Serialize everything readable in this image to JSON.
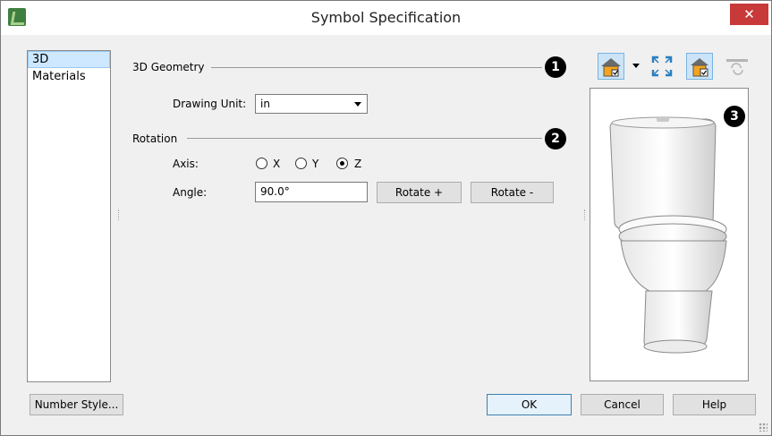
{
  "window": {
    "title": "Symbol Specification",
    "close_glyph": "✕"
  },
  "sidebar": {
    "items": [
      {
        "label": "3D",
        "selected": true
      },
      {
        "label": "Materials",
        "selected": false
      }
    ]
  },
  "geometry": {
    "section_label": "3D Geometry",
    "callout": "1",
    "drawing_unit_label": "Drawing Unit:",
    "drawing_unit_value": "in"
  },
  "rotation": {
    "section_label": "Rotation",
    "callout": "2",
    "axis_label": "Axis:",
    "axis_options": [
      "X",
      "Y",
      "Z"
    ],
    "axis_selected": "Z",
    "angle_label": "Angle:",
    "angle_value": "90.0°",
    "rotate_plus_label": "Rotate +",
    "rotate_minus_label": "Rotate -"
  },
  "preview": {
    "callout": "3",
    "subject": "toilet"
  },
  "toolbar": {
    "icons": [
      "view-mode-icon",
      "fill-window-icon",
      "render-toggle-icon",
      "reset-rotation-icon"
    ]
  },
  "footer": {
    "number_style_label": "Number Style...",
    "ok_label": "OK",
    "cancel_label": "Cancel",
    "help_label": "Help"
  },
  "colors": {
    "close": "#c83a3a",
    "selection": "#cde8ff",
    "accent": "#3c7fb1"
  }
}
